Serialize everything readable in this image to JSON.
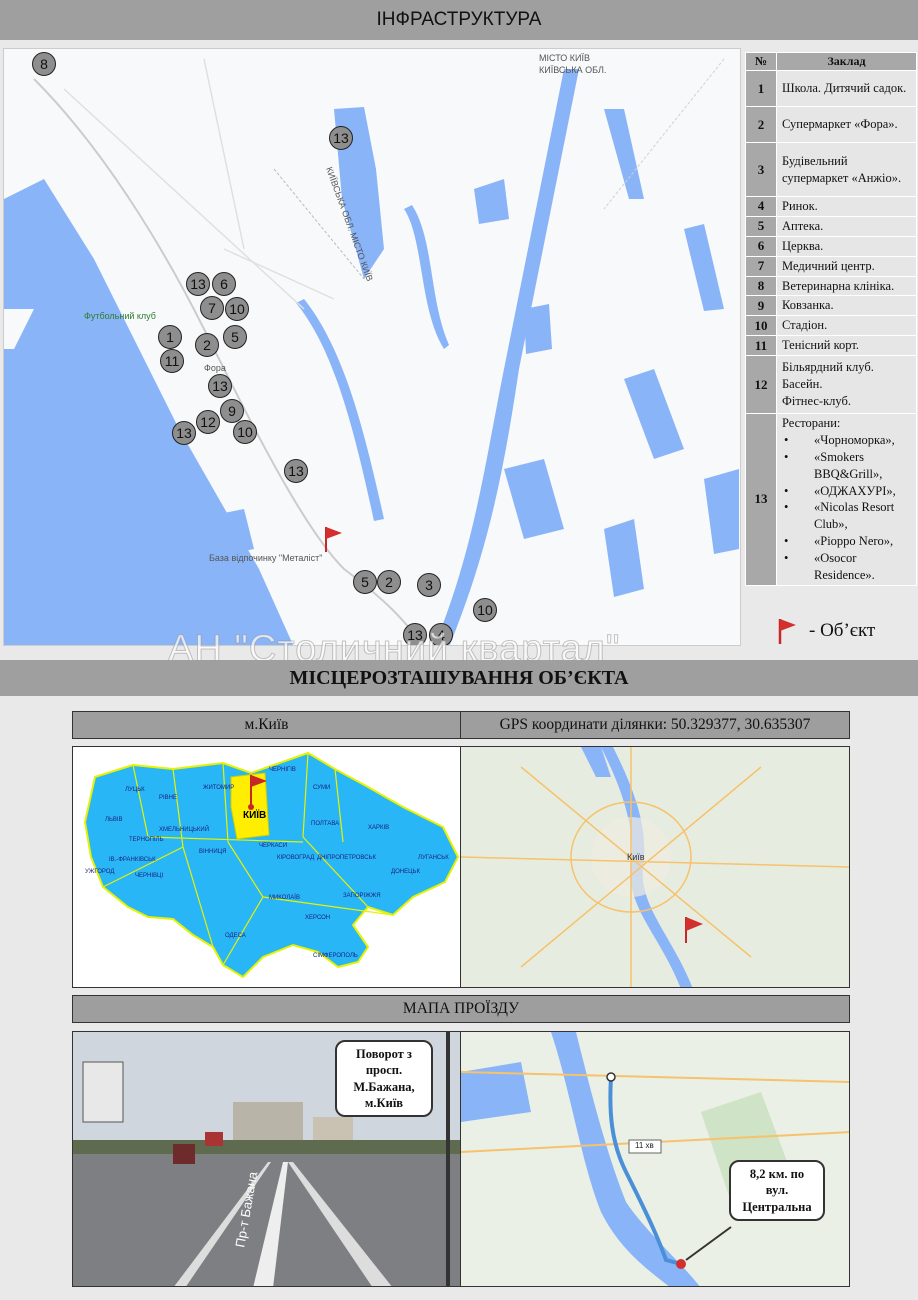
{
  "infrastructure_title": "ІНФРАСТРУКТУРА",
  "table": {
    "header_num": "№",
    "header_name": "Заклад",
    "rows": [
      {
        "num": "1",
        "name": "Школа. Дитячий садок."
      },
      {
        "num": "2",
        "name": "Супермаркет «Фора»."
      },
      {
        "num": "3",
        "name": "Будівельний супермаркет «Анжіо»."
      },
      {
        "num": "4",
        "name": "Ринок."
      },
      {
        "num": "5",
        "name": "Аптека."
      },
      {
        "num": "6",
        "name": "Церква."
      },
      {
        "num": "7",
        "name": "Медичний центр."
      },
      {
        "num": "8",
        "name": "Ветеринарна клініка."
      },
      {
        "num": "9",
        "name": "Ковзанка."
      },
      {
        "num": "10",
        "name": "Стадіон."
      },
      {
        "num": "11",
        "name": "Тенісний корт."
      },
      {
        "num": "12",
        "name_lines": [
          "Більярдний клуб.",
          "Басейн.",
          "Фітнес-клуб."
        ]
      },
      {
        "num": "13",
        "title": "Ресторани:",
        "items": [
          "«Чорноморка»,",
          "«Smokers BBQ&Grill»,",
          "«ОДЖАХУРІ»,",
          "«Nicolas Resort Club»,",
          "«Pioppo Nero»,",
          "«Osocor Residence»."
        ]
      }
    ]
  },
  "legend_label": "- Об’єкт",
  "watermark": "АН \"Столичний квартал\"",
  "infra_map": {
    "pins": [
      "8",
      "13",
      "13",
      "6",
      "7",
      "10",
      "1",
      "2",
      "5",
      "11",
      "13",
      "9",
      "12",
      "13",
      "10",
      "13",
      "5",
      "2",
      "3",
      "10",
      "13",
      "4"
    ],
    "labels": [
      "МІСТО КИЇВ",
      "КИЇВСЬКА ОБЛ.",
      "КИЇВСЬКА ОБЛ. МІСТО КИЇВ",
      "Футбольний клуб",
      "Фора",
      "База відпочинку \"Металіст\""
    ]
  },
  "location_title": "МІСЦЕРОЗТАШУВАННЯ ОБ’ЄКТА",
  "city_label": "м.Київ",
  "gps_label": "GPS координати ділянки: 50.329377, 30.635307",
  "ukraine_map": {
    "highlight": "КИЇВ",
    "regions": [
      "ЛУЦЬК",
      "РІВНЕ",
      "ЖИТОМИР",
      "ЧЕРНІГІВ",
      "СУМИ",
      "ЛЬВІВ",
      "ТЕРНОПІЛЬ",
      "ХМЕЛЬНИЦЬКИЙ",
      "ІВ.-ФРАНКІВСЬК",
      "УЖГОРОД",
      "ЧЕРНІВЦІ",
      "ВІННИЦЯ",
      "ЧЕРКАСИ",
      "ПОЛТАВА",
      "ХАРКІВ",
      "КІРОВОГРАД",
      "ДНІПРОПЕТРОВСЬК",
      "ЛУГАНСЬК",
      "ДОНЕЦЬК",
      "МИКОЛАЇВ",
      "ЗАПОРІЖЖЯ",
      "ОДЕСА",
      "ХЕРСОН",
      "СІМФЕРОПОЛЬ"
    ]
  },
  "kyiv_map": {
    "label": "Київ"
  },
  "route_title": "МАПА ПРОЇЗДУ",
  "street_bubble": [
    "Поворот з просп.",
    "М.Бажана,",
    "м.Київ"
  ],
  "street_sign": "Пр-т Бажана",
  "route_bubble": [
    "8,2 км. по",
    "вул.",
    "Центральна"
  ],
  "route_time": "11 хв",
  "colors": {
    "band": "#9f9f9f",
    "water": "#8ab4f8",
    "ukraine": "#29b6f6",
    "kyiv_region": "#ffee00",
    "route": "#4a90d9",
    "flag": "#d32f2f"
  }
}
